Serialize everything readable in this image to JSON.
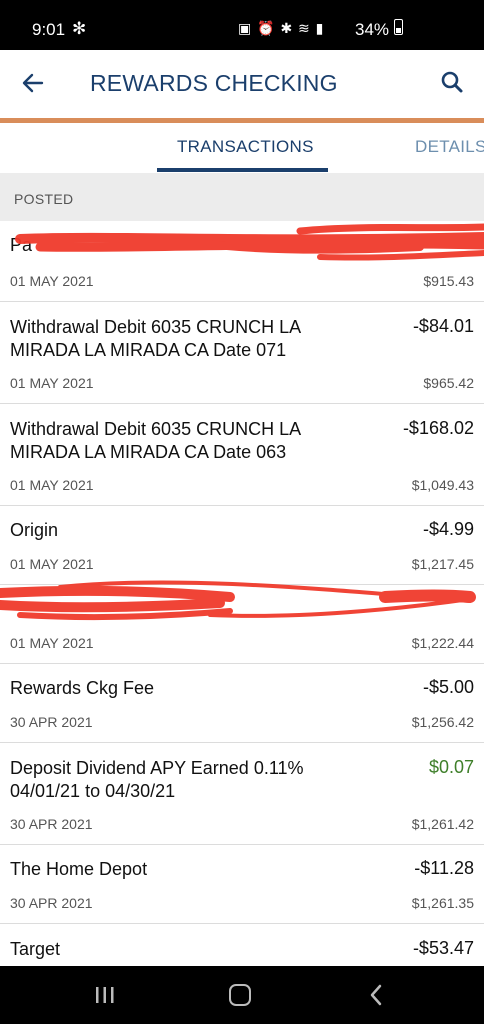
{
  "status": {
    "time": "9:01",
    "battery": "34%"
  },
  "appbar": {
    "title": "REWARDS CHECKING"
  },
  "tabs": {
    "transactions": "TRANSACTIONS",
    "details": "DETAILS"
  },
  "section": {
    "label": "POSTED"
  },
  "transactions": [
    {
      "desc": "Pa",
      "amount": "",
      "date": "01 MAY 2021",
      "balance": "$915.43"
    },
    {
      "desc": "Withdrawal Debit 6035 CRUNCH LA MIRADA LA MIRADA CA Date 071",
      "amount": "-$84.01",
      "date": "01 MAY 2021",
      "balance": "$965.42"
    },
    {
      "desc": "Withdrawal Debit 6035 CRUNCH LA MIRADA LA MIRADA CA Date 063",
      "amount": "-$168.02",
      "date": "01 MAY 2021",
      "balance": "$1,049.43"
    },
    {
      "desc": "Origin",
      "amount": "-$4.99",
      "date": "01 MAY 2021",
      "balance": "$1,217.45"
    },
    {
      "desc": "",
      "amount": "",
      "date": "01 MAY 2021",
      "balance": "$1,222.44"
    },
    {
      "desc": "Rewards Ckg Fee",
      "amount": "-$5.00",
      "date": "30 APR 2021",
      "balance": "$1,256.42"
    },
    {
      "desc": "Deposit Dividend APY Earned 0.11% 04/01/21 to 04/30/21",
      "amount": "$0.07",
      "date": "30 APR 2021",
      "balance": "$1,261.42"
    },
    {
      "desc": "The Home Depot",
      "amount": "-$11.28",
      "date": "30 APR 2021",
      "balance": "$1,261.35"
    },
    {
      "desc": "Target",
      "amount": "-$53.47",
      "date": "",
      "balance": ""
    }
  ],
  "colors": {
    "primary": "#1b3f6c",
    "accent": "#d98d5a",
    "positive": "#3f7f2a",
    "redaction": "#f03a2c"
  },
  "icons": [
    "back-arrow-icon",
    "search-icon",
    "recents-icon",
    "home-icon",
    "back-icon"
  ]
}
